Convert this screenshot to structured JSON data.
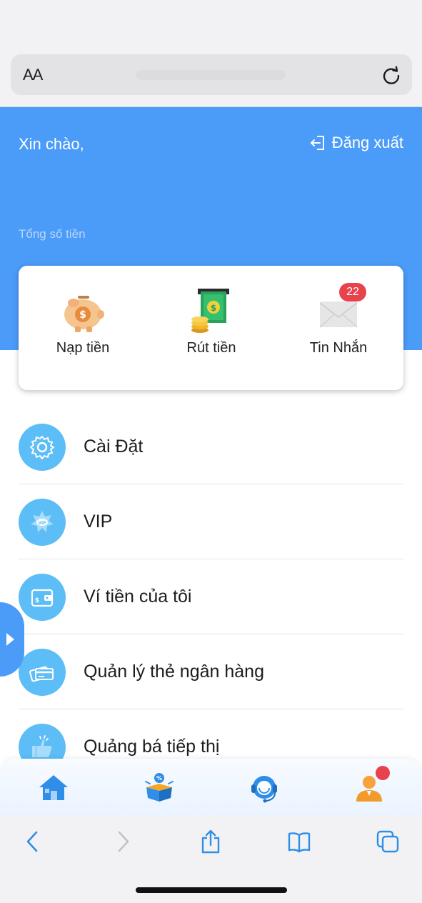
{
  "browser": {
    "text_size_label": "AA",
    "reload_icon": "reload-icon"
  },
  "header": {
    "greeting": "Xin chào,",
    "logout_label": "Đăng xuất",
    "total_label": "Tổng số tiền",
    "background_color": "#4b9bf8"
  },
  "actions": [
    {
      "label": "Nạp tiền",
      "icon": "piggy-bank-icon"
    },
    {
      "label": "Rút tiền",
      "icon": "withdraw-money-icon"
    },
    {
      "label": "Tin Nhắn",
      "icon": "mail-icon",
      "badge": "22"
    }
  ],
  "menu": [
    {
      "label": "Cài Đặt",
      "icon": "gear-icon"
    },
    {
      "label": "VIP",
      "icon": "vip-star-icon"
    },
    {
      "label": "Ví tiền của tôi",
      "icon": "wallet-icon"
    },
    {
      "label": "Quản lý thẻ ngân hàng",
      "icon": "bank-card-icon"
    },
    {
      "label": "Quảng bá tiếp thị",
      "icon": "thumbs-up-icon"
    }
  ],
  "bottom_nav": [
    {
      "icon": "home-icon"
    },
    {
      "icon": "promotion-box-icon"
    },
    {
      "icon": "customer-service-icon"
    },
    {
      "icon": "user-profile-icon",
      "has_notification": true
    }
  ],
  "accent_color": "#5cbdf7",
  "badge_color": "#e8424d"
}
